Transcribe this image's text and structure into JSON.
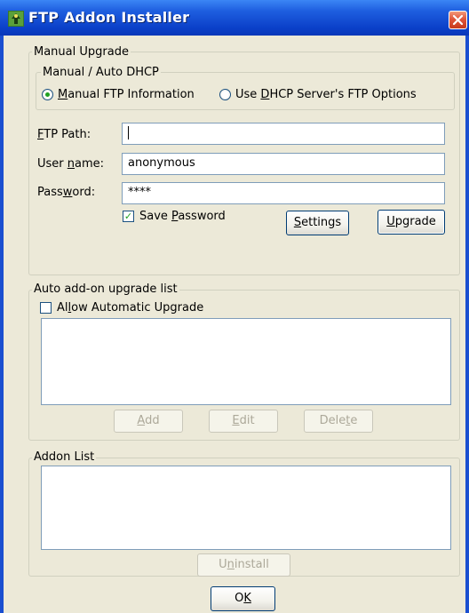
{
  "window": {
    "title": "FTP Addon Installer"
  },
  "manual_upgrade": {
    "legend": "Manual Upgrade",
    "dhcp_group": {
      "legend": "Manual / Auto DHCP",
      "radio_manual": {
        "pre": "",
        "accel": "M",
        "post": "anual FTP Information",
        "selected": true
      },
      "radio_dhcp": {
        "pre": "Use ",
        "accel": "D",
        "post": "HCP Server's FTP Options",
        "selected": false
      }
    },
    "ftp_path": {
      "pre": "",
      "accel": "F",
      "post": "TP Path:",
      "value": ""
    },
    "user_name": {
      "pre": "User ",
      "accel": "n",
      "post": "ame:",
      "value": "anonymous"
    },
    "password": {
      "pre": "Pass",
      "accel": "w",
      "post": "ord:",
      "value": "****"
    },
    "save_password": {
      "pre": "Save ",
      "accel": "P",
      "post": "assword",
      "checked": true
    },
    "settings_button": {
      "pre": "",
      "accel": "S",
      "post": "ettings"
    },
    "upgrade_button": {
      "pre": "",
      "accel": "U",
      "post": "pgrade"
    }
  },
  "auto_list": {
    "legend": "Auto add-on upgrade list",
    "allow_auto": {
      "pre": "Al",
      "accel": "l",
      "post": "ow Automatic Upgrade",
      "checked": false
    },
    "add_button": {
      "pre": "",
      "accel": "A",
      "post": "dd"
    },
    "edit_button": {
      "pre": "",
      "accel": "E",
      "post": "dit"
    },
    "delete_button": {
      "pre": "Dele",
      "accel": "t",
      "post": "e"
    }
  },
  "addon_list": {
    "legend": "Addon List",
    "uninstall_button": {
      "pre": "U",
      "accel": "n",
      "post": "install"
    }
  },
  "ok_button": {
    "pre": "O",
    "accel": "K",
    "post": ""
  },
  "colors": {
    "titlebar": "#0a3fc8",
    "dialog_bg": "#ece9d8",
    "close": "#e0553a",
    "radio_dot": "#21a121"
  }
}
